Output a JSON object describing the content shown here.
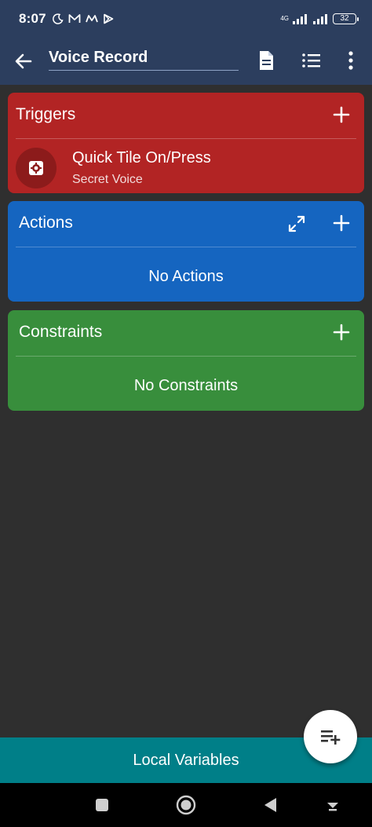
{
  "status_bar": {
    "time": "8:07",
    "network_label": "4G",
    "battery": "32"
  },
  "app_bar": {
    "title": "Voice Record",
    "icons": [
      "arrow-back-icon",
      "document-icon",
      "list-icon",
      "more-vert-icon"
    ]
  },
  "triggers": {
    "title": "Triggers",
    "color": "#b22424",
    "items": [
      {
        "title": "Quick Tile On/Press",
        "subtitle": "Secret Voice",
        "icon": "gear-icon"
      }
    ]
  },
  "actions": {
    "title": "Actions",
    "color": "#1565c0",
    "empty_text": "No Actions"
  },
  "constraints": {
    "title": "Constraints",
    "color": "#388e3c",
    "empty_text": "No Constraints"
  },
  "bottom_bar": {
    "label": "Local Variables",
    "color": "#007f88"
  },
  "fab": {
    "icon": "playlist-add-icon"
  },
  "nav_bar": {
    "icons": [
      "square-icon",
      "circle-icon",
      "triangle-back-icon",
      "down-arrow-icon"
    ]
  }
}
